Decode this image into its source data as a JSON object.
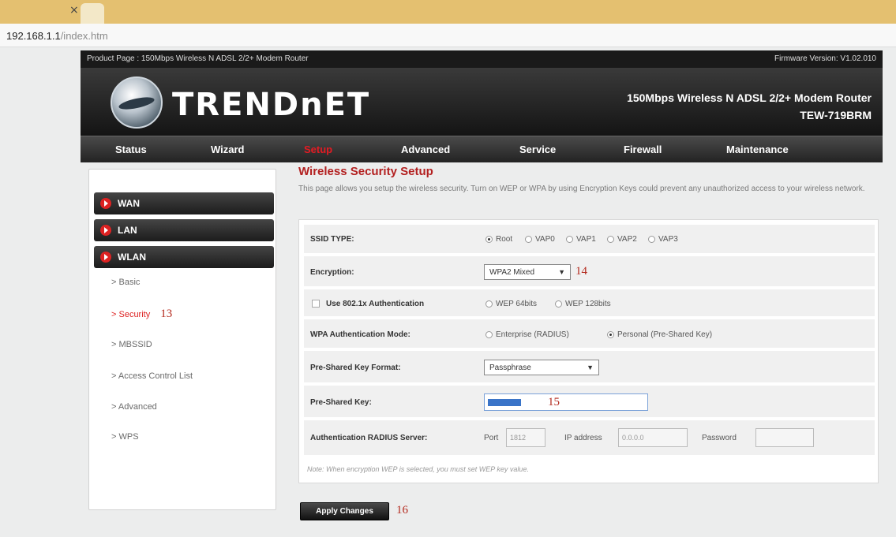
{
  "browser": {
    "tab_close": "×",
    "url_host": "192.168.1.1",
    "url_path": "/index.htm"
  },
  "router": {
    "product_page": "Product Page : 150Mbps Wireless N ADSL 2/2+ Modem Router",
    "firmware": "Firmware Version: V1.02.010",
    "logo": "TRENDnET",
    "product_name": "150Mbps Wireless N ADSL 2/2+ Modem Router",
    "model": "TEW-719BRM"
  },
  "nav": [
    "Status",
    "Wizard",
    "Setup",
    "Advanced",
    "Service",
    "Firewall",
    "Maintenance"
  ],
  "sidebar": {
    "main": [
      "WAN",
      "LAN",
      "WLAN"
    ],
    "sub": [
      "Basic",
      "Security",
      "MBSSID",
      "Access Control List",
      "Advanced",
      "WPS"
    ]
  },
  "annotations": {
    "a13": "13",
    "a14": "14",
    "a15": "15",
    "a16": "16"
  },
  "page": {
    "title": "Wireless Security Setup",
    "description": "This page allows you setup the wireless security. Turn on WEP or WPA by using Encryption Keys could prevent any unauthorized access to your wireless network."
  },
  "form": {
    "ssid_type_label": "SSID TYPE:",
    "ssid_options": [
      "Root",
      "VAP0",
      "VAP1",
      "VAP2",
      "VAP3"
    ],
    "ssid_selected": "Root",
    "encryption_label": "Encryption:",
    "encryption_value": "WPA2 Mixed",
    "use8021x_label": "Use 802.1x Authentication",
    "wep_options": [
      "WEP 64bits",
      "WEP 128bits"
    ],
    "wpa_mode_label": "WPA Authentication Mode:",
    "wpa_mode_options": [
      "Enterprise (RADIUS)",
      "Personal (Pre-Shared Key)"
    ],
    "wpa_mode_selected": "Personal (Pre-Shared Key)",
    "psk_format_label": "Pre-Shared Key Format:",
    "psk_format_value": "Passphrase",
    "psk_label": "Pre-Shared Key:",
    "radius_label": "Authentication RADIUS Server:",
    "port_label": "Port",
    "port_value": "1812",
    "ip_label": "IP address",
    "ip_value": "0.0.0.0",
    "password_label": "Password",
    "note": "Note: When encryption WEP is selected, you must set WEP key value."
  },
  "apply_label": "Apply Changes",
  "colors": {
    "accent_red": "#b32020",
    "nav_dark": "#232323",
    "annotation": "#b42a1e"
  }
}
